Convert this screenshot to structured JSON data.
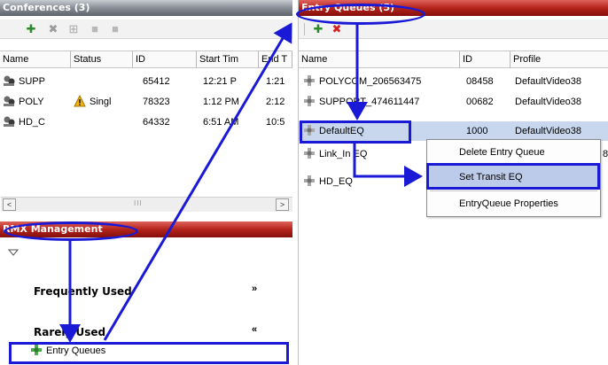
{
  "conferences": {
    "title": "Conferences (3)",
    "columns": [
      "Name",
      "Status",
      "ID",
      "Start Tim",
      "End T"
    ],
    "rows": [
      {
        "name": "SUPP",
        "status": "",
        "id": "65412",
        "start": "12:21 P",
        "end": "1:21"
      },
      {
        "name": "POLY",
        "status": "Singl",
        "id": "78323",
        "start": "1:12 PM",
        "end": "2:12"
      },
      {
        "name": "HD_C",
        "status": "",
        "id": "64332",
        "start": "6:51 AM",
        "end": "10:5"
      }
    ],
    "scroll_thumb": "III"
  },
  "entry_queues": {
    "title": "Entry Queues (5)",
    "columns": [
      "Name",
      "ID",
      "Profile"
    ],
    "rows": [
      {
        "name": "POLYCOM_206563475",
        "id": "08458",
        "profile": "DefaultVideo38"
      },
      {
        "name": "SUPPORT_474611447",
        "id": "00682",
        "profile": "DefaultVideo38"
      },
      {
        "name": "DefaultEQ",
        "id": "1000",
        "profile": "DefaultVideo38"
      },
      {
        "name": "Link_In EQ",
        "id": "",
        "profile": "8"
      },
      {
        "name": "HD_EQ",
        "id": "",
        "profile": ""
      }
    ]
  },
  "context_menu": {
    "items": [
      "Delete Entry Queue",
      "Set Transit EQ",
      "EntryQueue Properties"
    ]
  },
  "rmx": {
    "title": "RMX Management",
    "frequently_used": "Frequently Used",
    "rarely_used": "Rarely Used",
    "entry_queues_item": "Entry Queues"
  },
  "colors": {
    "highlight": "#1a1ad6",
    "selected_row": "#c9d7ee",
    "menu_highlight": "#bccbe9",
    "title_red": "#b3231b",
    "title_grey": "#8e939b"
  }
}
